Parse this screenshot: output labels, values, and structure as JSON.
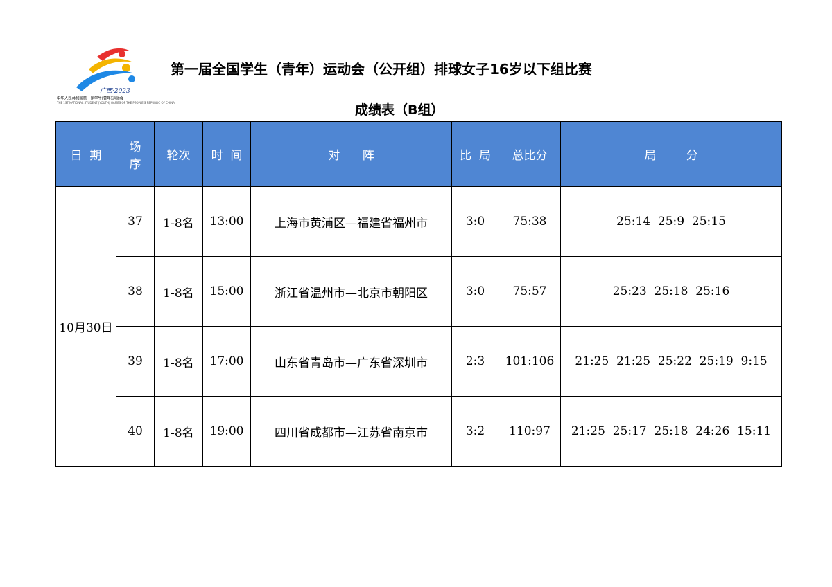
{
  "logo": {
    "year_text": "广西·2023",
    "org_text": "中华人民共和国第一届学生(青年)运动会",
    "org_text_en": "THE 1ST NATIONAL STUDENT (YOUTH) GAMES OF THE PEOPLE'S REPUBLIC OF CHINA",
    "colors": [
      "#e8312f",
      "#f4b400",
      "#1e88e5",
      "#1d3f8f"
    ]
  },
  "document": {
    "title": "第一届全国学生（青年）运动会（公开组）排球女子16岁以下组比赛",
    "subtitle": "成绩表（B组）"
  },
  "table": {
    "header_color": "#4f86d3",
    "headers": {
      "date": "日  期",
      "match_no": "场\n序",
      "round": "轮次",
      "time": "时  间",
      "matchup": "对      阵",
      "score": "比  局",
      "total_points": "总比分",
      "set_scores": "局        分"
    },
    "date": "10月30日",
    "rows": [
      {
        "match_no": "37",
        "round": "1-8名",
        "time": "13:00",
        "matchup": "上海市黄浦区—福建省福州市",
        "score": "3:0",
        "total_points": "75:38",
        "set_scores": "25:14  25:9  25:15"
      },
      {
        "match_no": "38",
        "round": "1-8名",
        "time": "15:00",
        "matchup": "浙江省温州市—北京市朝阳区",
        "score": "3:0",
        "total_points": "75:57",
        "set_scores": "25:23  25:18  25:16"
      },
      {
        "match_no": "39",
        "round": "1-8名",
        "time": "17:00",
        "matchup": "山东省青岛市—广东省深圳市",
        "score": "2:3",
        "total_points": "101:106",
        "set_scores": "21:25  21:25  25:22  25:19  9:15"
      },
      {
        "match_no": "40",
        "round": "1-8名",
        "time": "19:00",
        "matchup": "四川省成都市—江苏省南京市",
        "score": "3:2",
        "total_points": "110:97",
        "set_scores": "21:25  25:17  25:18  24:26  15:11"
      }
    ]
  }
}
